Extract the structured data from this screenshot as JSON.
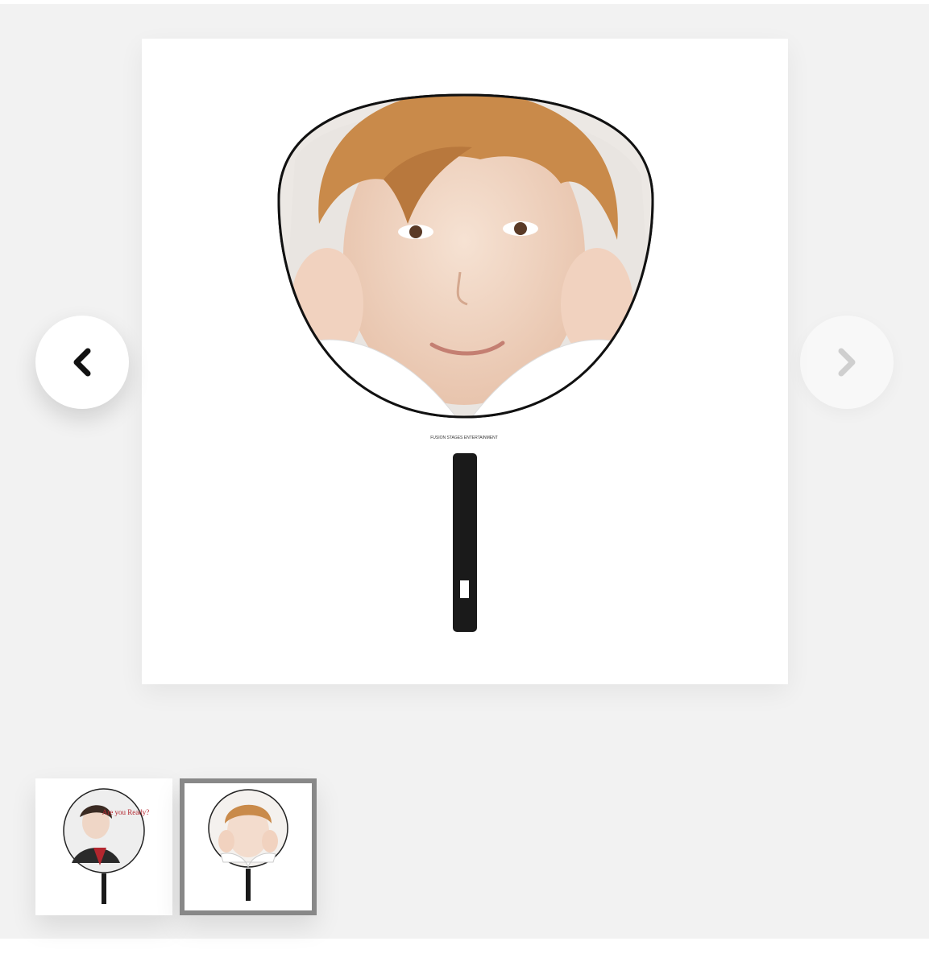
{
  "gallery": {
    "active_index": 2,
    "main_image": {
      "fan_print_text": "FUSION STAGES ENTERTAINMENT"
    },
    "prev_icon": "chevron-left-icon",
    "next_icon": "chevron-right-icon",
    "thumbnails": [
      {
        "index": 1,
        "selected": false,
        "print_text": "Are you Ready?"
      },
      {
        "index": 2,
        "selected": true
      }
    ]
  },
  "colors": {
    "background": "#f2f2f2",
    "selected_border": "#888888",
    "fan_handle": "#1a1a1a",
    "hair": "#c98a4a"
  }
}
